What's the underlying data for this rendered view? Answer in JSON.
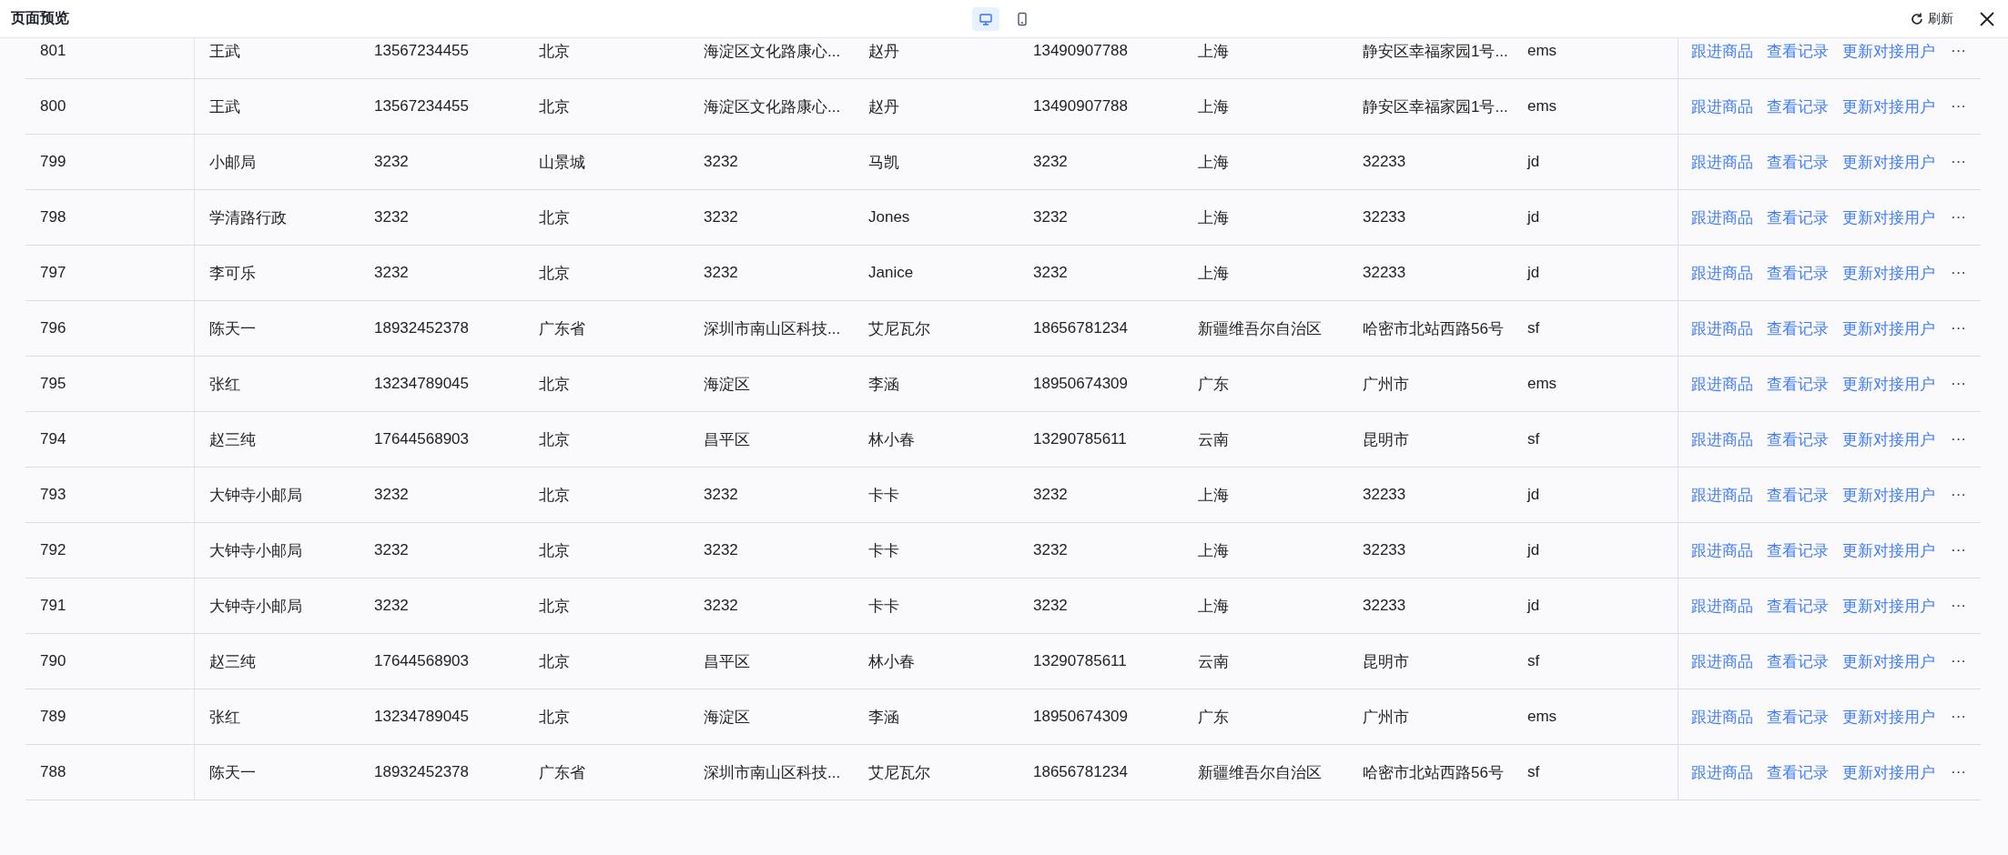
{
  "window": {
    "title": "页面预览"
  },
  "view_toggle": [
    {
      "kind": "desktop",
      "selected": true
    },
    {
      "kind": "mobile",
      "selected": false
    }
  ],
  "refresh_button": {
    "label": "刷新"
  },
  "table": {
    "rows": [
      {
        "cells": [
          "801",
          "王武",
          "13567234455",
          "北京",
          "海淀区文化路康心...",
          "赵丹",
          "13490907788",
          "上海",
          "静安区幸福家园1号...",
          "ems"
        ],
        "actions": [
          "跟进商品",
          "查看记录",
          "更新对接用户"
        ],
        "more": "···"
      },
      {
        "cells": [
          "800",
          "王武",
          "13567234455",
          "北京",
          "海淀区文化路康心...",
          "赵丹",
          "13490907788",
          "上海",
          "静安区幸福家园1号...",
          "ems"
        ],
        "actions": [
          "跟进商品",
          "查看记录",
          "更新对接用户"
        ],
        "more": "···"
      },
      {
        "cells": [
          "799",
          "小邮局",
          "3232",
          "山景城",
          "3232",
          "马凯",
          "3232",
          "上海",
          "32233",
          "jd"
        ],
        "actions": [
          "跟进商品",
          "查看记录",
          "更新对接用户"
        ],
        "more": "···"
      },
      {
        "cells": [
          "798",
          "学清路行政",
          "3232",
          "北京",
          "3232",
          "Jones",
          "3232",
          "上海",
          "32233",
          "jd"
        ],
        "actions": [
          "跟进商品",
          "查看记录",
          "更新对接用户"
        ],
        "more": "···"
      },
      {
        "cells": [
          "797",
          "李可乐",
          "3232",
          "北京",
          "3232",
          "Janice",
          "3232",
          "上海",
          "32233",
          "jd"
        ],
        "actions": [
          "跟进商品",
          "查看记录",
          "更新对接用户"
        ],
        "more": "···"
      },
      {
        "cells": [
          "796",
          "陈天一",
          "18932452378",
          "广东省",
          "深圳市南山区科技...",
          "艾尼瓦尔",
          "18656781234",
          "新疆维吾尔自治区",
          "哈密市北站西路56号",
          "sf"
        ],
        "actions": [
          "跟进商品",
          "查看记录",
          "更新对接用户"
        ],
        "more": "···"
      },
      {
        "cells": [
          "795",
          "张红",
          "13234789045",
          "北京",
          "海淀区",
          "李涵",
          "18950674309",
          "广东",
          "广州市",
          "ems"
        ],
        "actions": [
          "跟进商品",
          "查看记录",
          "更新对接用户"
        ],
        "more": "···"
      },
      {
        "cells": [
          "794",
          "赵三纯",
          "17644568903",
          "北京",
          "昌平区",
          "林小春",
          "13290785611",
          "云南",
          "昆明市",
          "sf"
        ],
        "actions": [
          "跟进商品",
          "查看记录",
          "更新对接用户"
        ],
        "more": "···"
      },
      {
        "cells": [
          "793",
          "大钟寺小邮局",
          "3232",
          "北京",
          "3232",
          "卡卡",
          "3232",
          "上海",
          "32233",
          "jd"
        ],
        "actions": [
          "跟进商品",
          "查看记录",
          "更新对接用户"
        ],
        "more": "···"
      },
      {
        "cells": [
          "792",
          "大钟寺小邮局",
          "3232",
          "北京",
          "3232",
          "卡卡",
          "3232",
          "上海",
          "32233",
          "jd"
        ],
        "actions": [
          "跟进商品",
          "查看记录",
          "更新对接用户"
        ],
        "more": "···"
      },
      {
        "cells": [
          "791",
          "大钟寺小邮局",
          "3232",
          "北京",
          "3232",
          "卡卡",
          "3232",
          "上海",
          "32233",
          "jd"
        ],
        "actions": [
          "跟进商品",
          "查看记录",
          "更新对接用户"
        ],
        "more": "···"
      },
      {
        "cells": [
          "790",
          "赵三纯",
          "17644568903",
          "北京",
          "昌平区",
          "林小春",
          "13290785611",
          "云南",
          "昆明市",
          "sf"
        ],
        "actions": [
          "跟进商品",
          "查看记录",
          "更新对接用户"
        ],
        "more": "···"
      },
      {
        "cells": [
          "789",
          "张红",
          "13234789045",
          "北京",
          "海淀区",
          "李涵",
          "18950674309",
          "广东",
          "广州市",
          "ems"
        ],
        "actions": [
          "跟进商品",
          "查看记录",
          "更新对接用户"
        ],
        "more": "···"
      },
      {
        "cells": [
          "788",
          "陈天一",
          "18932452378",
          "广东省",
          "深圳市南山区科技...",
          "艾尼瓦尔",
          "18656781234",
          "新疆维吾尔自治区",
          "哈密市北站西路56号",
          "sf"
        ],
        "actions": [
          "跟进商品",
          "查看记录",
          "更新对接用户"
        ],
        "more": "···"
      }
    ]
  }
}
